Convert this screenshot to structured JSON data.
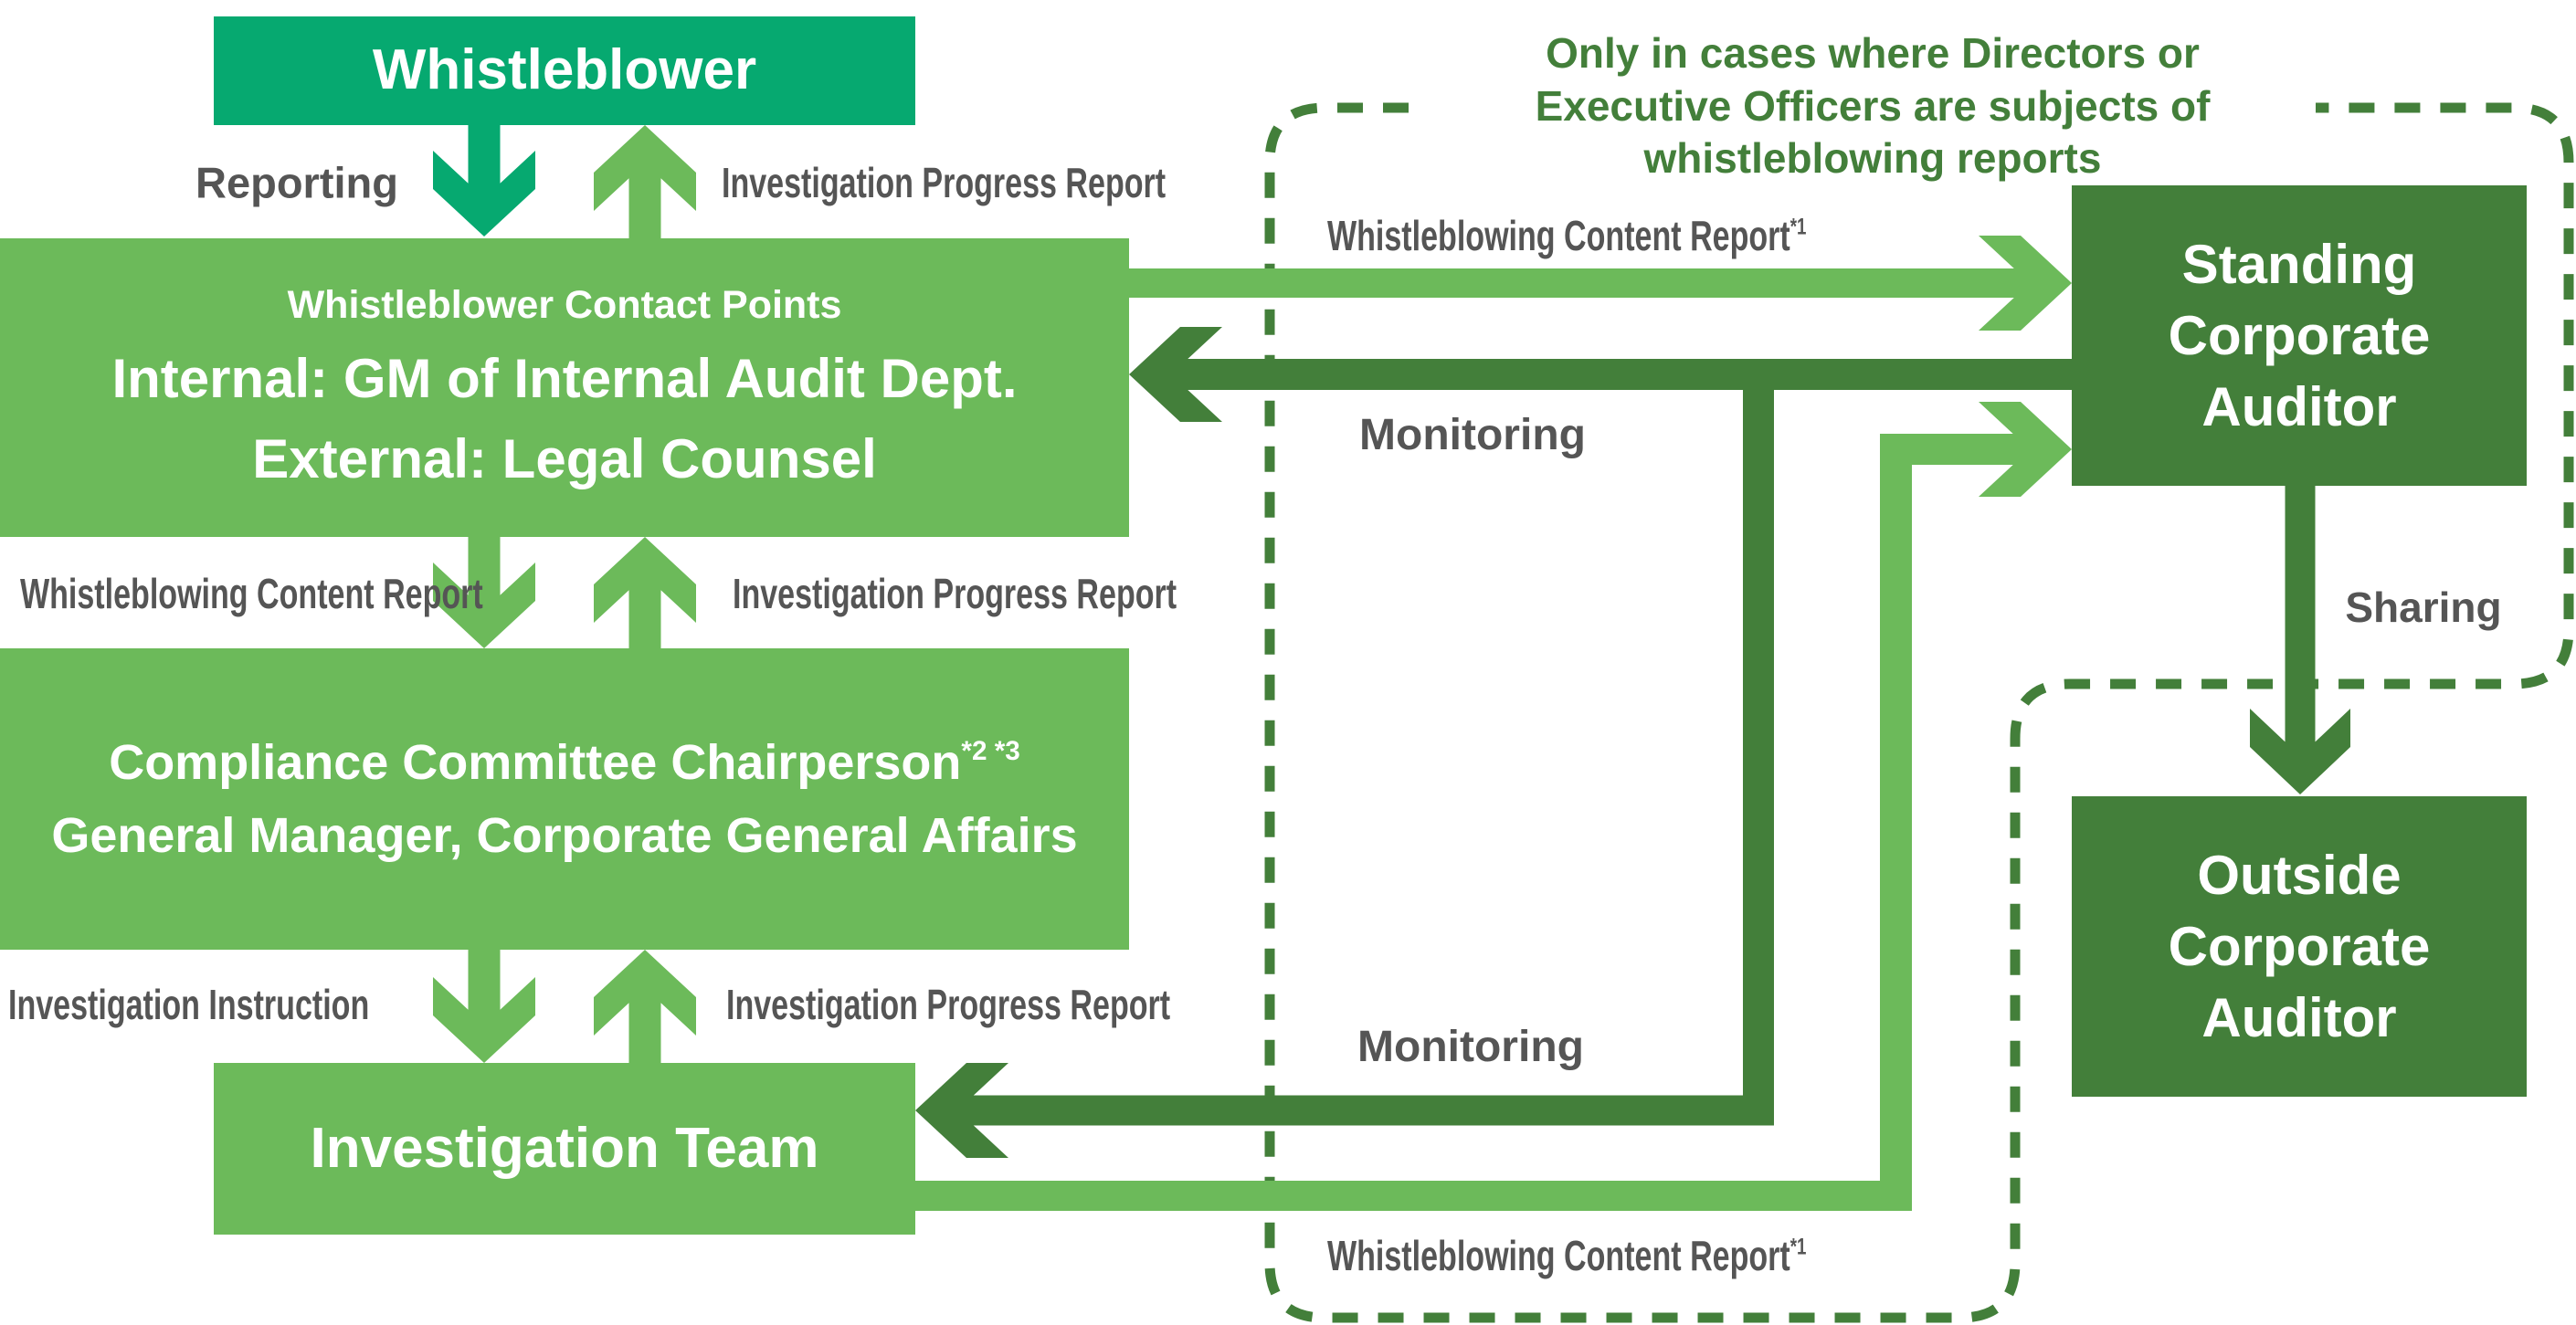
{
  "colors": {
    "whistleblower": "#06a970",
    "light_green": "#6cba5a",
    "dark_green": "#437f3a",
    "label_gray": "#555555"
  },
  "boxes": {
    "whistleblower": "Whistleblower",
    "contact_points": {
      "title": "Whistleblower Contact Points",
      "internal": "Internal: GM of Internal Audit Dept.",
      "external": "External: Legal Counsel"
    },
    "compliance": {
      "line1": "Compliance Committee Chairperson",
      "line1_notes": "*2 *3",
      "line2": "General Manager, Corporate General Affairs"
    },
    "investigation_team": "Investigation Team",
    "standing_auditor": [
      "Standing",
      "Corporate",
      "Auditor"
    ],
    "outside_auditor": [
      "Outside",
      "Corporate",
      "Auditor"
    ]
  },
  "labels": {
    "reporting": "Reporting",
    "progress_report_1": "Investigation Progress Report",
    "content_report_left": "Whistleblowing Content Report",
    "progress_report_2": "Investigation Progress Report",
    "investigation_instruction": "Investigation Instruction",
    "progress_report_3": "Investigation Progress Report",
    "content_report_top": "Whistleblowing Content Report",
    "content_report_bottom": "Whistleblowing Content Report",
    "footnote_1": "*1",
    "monitoring_top": "Monitoring",
    "monitoring_bottom": "Monitoring",
    "sharing": "Sharing"
  },
  "region_note": [
    "Only in cases where Directors or",
    "Executive Officers are subjects of",
    "whistleblowing reports"
  ]
}
